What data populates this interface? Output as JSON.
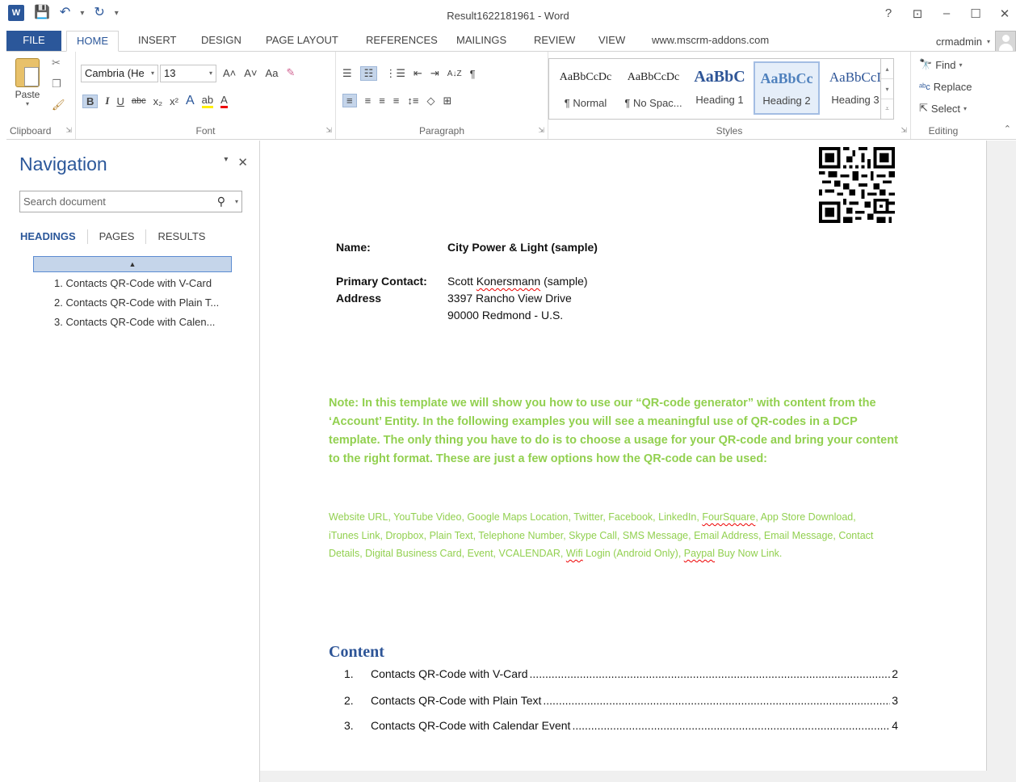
{
  "window": {
    "title": "Result1622181961 - Word",
    "help": "?",
    "restore_ribbon": "⊡",
    "minimize": "–",
    "maximize": "☐",
    "close": "✕"
  },
  "qat": {
    "app_icon": "W",
    "save": "💾",
    "undo": "↶",
    "redo": "↻",
    "customize": "▾"
  },
  "tabs": {
    "file": "FILE",
    "home": "HOME",
    "insert": "INSERT",
    "design": "DESIGN",
    "page_layout": "PAGE LAYOUT",
    "references": "REFERENCES",
    "mailings": "MAILINGS",
    "review": "REVIEW",
    "view": "VIEW",
    "addons": "www.mscrm-addons.com"
  },
  "account": {
    "user": "crmadmin"
  },
  "ribbon": {
    "clipboard": {
      "label": "Clipboard",
      "paste": "Paste"
    },
    "font": {
      "label": "Font",
      "font_name": "Cambria (He",
      "font_size": "13",
      "grow": "A˄",
      "shrink": "A˅",
      "case": "Aa",
      "clear": "✎",
      "bold": "B",
      "italic": "I",
      "underline": "U",
      "strike": "abc",
      "subscript": "x₂",
      "superscript": "x²",
      "effects": "A",
      "highlight": "ab",
      "font_color": "A"
    },
    "paragraph": {
      "label": "Paragraph",
      "bullets": "☰",
      "numbering": "☷",
      "multilevel": "⋮☰",
      "decrease_indent": "⇤",
      "increase_indent": "⇥",
      "sort": "A↓Z",
      "show_marks": "¶",
      "align_left": "≡",
      "center": "≡",
      "align_right": "≡",
      "justify": "≡",
      "line_spacing": "↕≡",
      "shading": "◇",
      "borders": "⊞"
    },
    "styles": {
      "label": "Styles",
      "items": [
        {
          "sample": "AaBbCcDc",
          "name": "¶ Normal"
        },
        {
          "sample": "AaBbCcDc",
          "name": "¶ No Spac..."
        },
        {
          "sample": "AaBbC",
          "name": "Heading 1"
        },
        {
          "sample": "AaBbCc",
          "name": "Heading 2"
        },
        {
          "sample": "AaBbCcI",
          "name": "Heading 3"
        }
      ]
    },
    "editing": {
      "label": "Editing",
      "find": "Find",
      "replace": "Replace",
      "select": "Select"
    }
  },
  "navigation": {
    "title": "Navigation",
    "search_placeholder": "Search document",
    "tabs": {
      "headings": "HEADINGS",
      "pages": "PAGES",
      "results": "RESULTS"
    },
    "headings": [
      "1. Contacts QR-Code with V-Card",
      "2. Contacts QR-Code with Plain T...",
      "3. Contacts QR-Code with Calen..."
    ]
  },
  "document": {
    "name_label": "Name:",
    "name_value": "City Power & Light (sample)",
    "contact_label": "Primary Contact:",
    "contact_first": "Scott ",
    "contact_last": "Konersmann",
    "contact_suffix": " (sample)",
    "address_label": "Address",
    "address_line1": "3397 Rancho View Drive",
    "address_line2": "90000 Redmond - U.S.",
    "note": "Note: In this template we will show you how to use our “QR-code generator” with content from the ‘Account’ Entity. In the following examples you will see a meaningful use of QR-codes in a DCP template. The only thing you have to do is to choose a usage for your QR-code and bring your content to the right format. These are just a few options how the QR-code can be used:",
    "usages_1": "Website URL, YouTube Video, Google Maps Location, Twitter, Facebook, LinkedIn, ",
    "usages_foursquare": "FourSquare",
    "usages_2": ", App Store Download, iTunes Link, Dropbox, Plain Text, Telephone Number, Skype Call, SMS Message, Email Address, Email Message, Contact Details, Digital Business Card, Event, VCALENDAR, ",
    "usages_wifi": "Wifi",
    "usages_3": " Login (Android Only), ",
    "usages_paypal": "Paypal",
    "usages_4": " Buy Now Link.",
    "content_heading": "Content",
    "toc": [
      {
        "num": "1.",
        "text": "Contacts QR-Code with V-Card",
        "page": "2"
      },
      {
        "num": "2.",
        "text": "Contacts QR-Code with Plain Text",
        "page": "3"
      },
      {
        "num": "3.",
        "text": "Contacts QR-Code with Calendar Event",
        "page": "4"
      }
    ]
  },
  "colors": {
    "word_blue": "#2b579a",
    "note_green": "#92d050",
    "heading_blue": "#2e5597"
  }
}
